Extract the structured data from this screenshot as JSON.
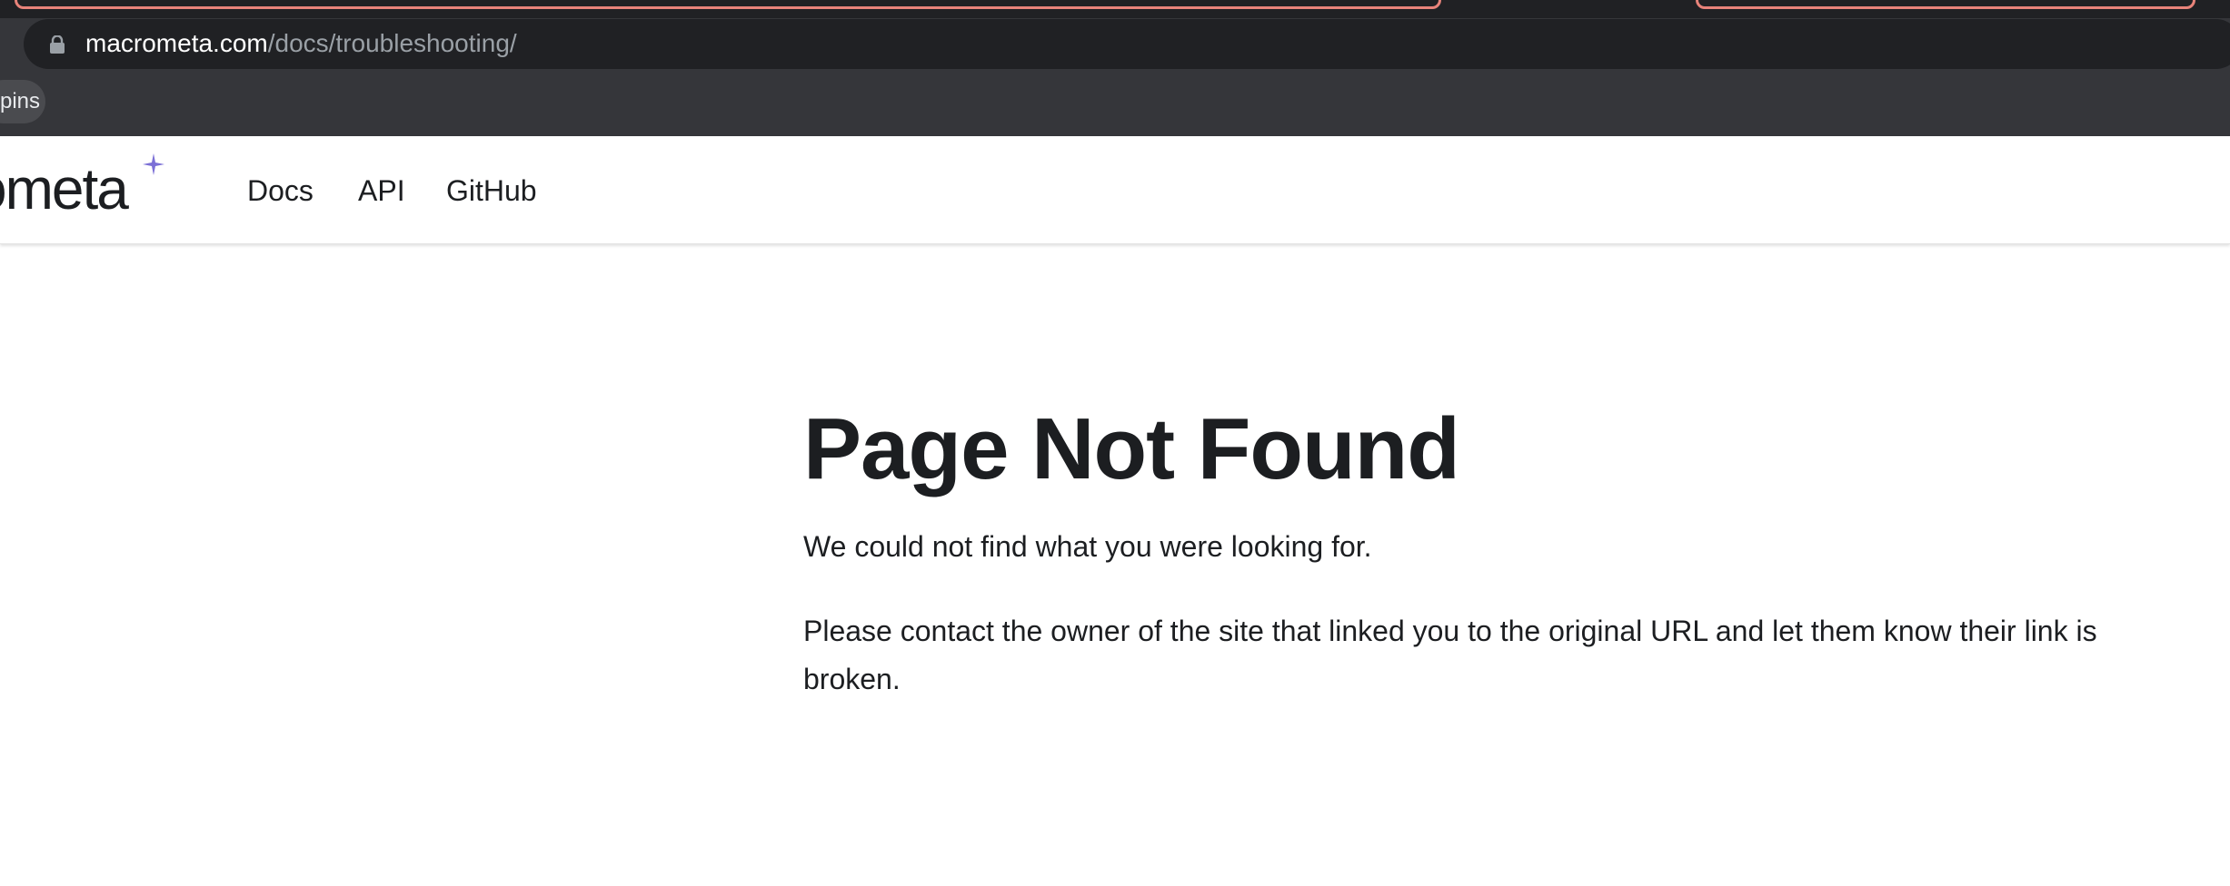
{
  "browser": {
    "url_host": "macrometa.com",
    "url_path": "/docs/troubleshooting/",
    "bookmark_label": "pins"
  },
  "header": {
    "logo_text": "ometa",
    "nav": [
      {
        "label": "Docs"
      },
      {
        "label": "API"
      },
      {
        "label": "GitHub"
      }
    ]
  },
  "main": {
    "title": "Page Not Found",
    "paragraphs": [
      "We could not find what you were looking for.",
      "Please contact the owner of the site that linked you to the original URL and let them know their link is broken."
    ]
  },
  "colors": {
    "chrome_bg": "#35363a",
    "omnibox_bg": "#202124",
    "tab_outline": "#e8837a",
    "text_primary": "#1c1e21",
    "logo_star": "#7b6fd6"
  },
  "icons": {
    "lock": "lock-icon",
    "logo_star": "sparkle-icon"
  }
}
